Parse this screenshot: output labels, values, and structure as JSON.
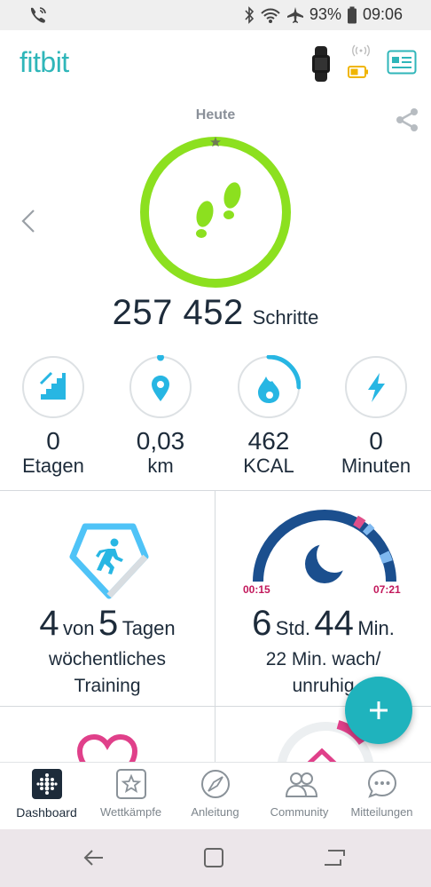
{
  "status_bar": {
    "battery_percent": "93%",
    "time": "09:06"
  },
  "app": {
    "logo": "fitbit",
    "brand_color": "#2fb6b9",
    "ring_color": "#8ce01f"
  },
  "today": {
    "label": "Heute",
    "steps_value": "257 452",
    "steps_unit": "Schritte",
    "steps_goal_fraction": 1.0
  },
  "stats": [
    {
      "icon": "stairs-icon",
      "value": "0",
      "unit": "Etagen",
      "progress": 0.0
    },
    {
      "icon": "location-pin-icon",
      "value": "0,03",
      "unit": "km",
      "progress": 0.01
    },
    {
      "icon": "flame-icon",
      "value": "462",
      "unit": "KCAL",
      "progress": 0.2
    },
    {
      "icon": "lightning-icon",
      "value": "0",
      "unit": "Minuten",
      "progress": 0.0
    }
  ],
  "tiles": {
    "exercise": {
      "big1": "4",
      "mid": "von",
      "big2": "5",
      "unit": "Tagen",
      "line1": "wöchentliches",
      "line2": "Training"
    },
    "sleep": {
      "start_time": "00:15",
      "end_time": "07:21",
      "hours": "6",
      "hours_unit": "Std.",
      "minutes": "44",
      "minutes_unit": "Min.",
      "line1": "22 Min. wach/",
      "line2": "unruhig"
    }
  },
  "fab": {
    "label": "+"
  },
  "bottom_nav": [
    {
      "label": "Dashboard",
      "icon": "dashboard-icon",
      "active": true
    },
    {
      "label": "Wettkämpfe",
      "icon": "challenges-star-icon",
      "active": false
    },
    {
      "label": "Anleitung",
      "icon": "compass-icon",
      "active": false
    },
    {
      "label": "Community",
      "icon": "community-icon",
      "active": false
    },
    {
      "label": "Mitteilungen",
      "icon": "messages-icon",
      "active": false
    }
  ]
}
